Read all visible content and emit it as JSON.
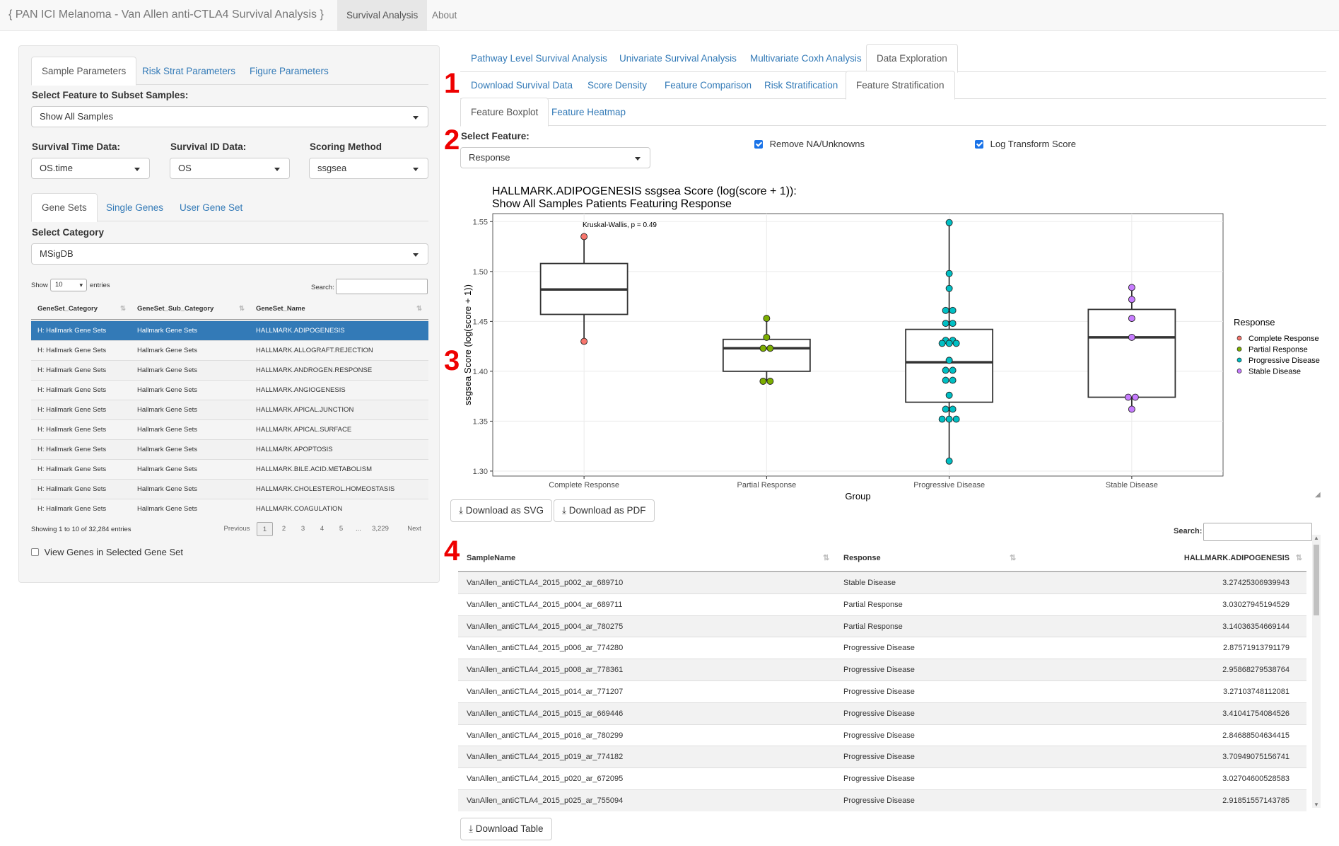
{
  "navbar": {
    "brand": "{ PAN ICI Melanoma - Van Allen anti-CTLA4 Survival Analysis }",
    "tabs": [
      "Survival Analysis",
      "About"
    ]
  },
  "sidebar": {
    "tabs": [
      "Sample Parameters",
      "Risk Strat Parameters",
      "Figure Parameters"
    ],
    "subset_label": "Select Feature to Subset Samples:",
    "subset_value": "Show All Samples",
    "survival_time_label": "Survival Time Data:",
    "survival_time_value": "OS.time",
    "survival_id_label": "Survival ID Data:",
    "survival_id_value": "OS",
    "scoring_label": "Scoring Method",
    "scoring_value": "ssgsea",
    "geneset_tabs": [
      "Gene Sets",
      "Single Genes",
      "User Gene Set"
    ],
    "category_label": "Select Category",
    "category_value": "MSigDB",
    "table": {
      "show": "Show",
      "length": "10",
      "entries": "entries",
      "search_label": "Search:",
      "columns": [
        "GeneSet_Category",
        "GeneSet_Sub_Category",
        "GeneSet_Name"
      ],
      "rows": [
        [
          "H: Hallmark Gene Sets",
          "Hallmark Gene Sets",
          "HALLMARK.ADIPOGENESIS"
        ],
        [
          "H: Hallmark Gene Sets",
          "Hallmark Gene Sets",
          "HALLMARK.ALLOGRAFT.REJECTION"
        ],
        [
          "H: Hallmark Gene Sets",
          "Hallmark Gene Sets",
          "HALLMARK.ANDROGEN.RESPONSE"
        ],
        [
          "H: Hallmark Gene Sets",
          "Hallmark Gene Sets",
          "HALLMARK.ANGIOGENESIS"
        ],
        [
          "H: Hallmark Gene Sets",
          "Hallmark Gene Sets",
          "HALLMARK.APICAL.JUNCTION"
        ],
        [
          "H: Hallmark Gene Sets",
          "Hallmark Gene Sets",
          "HALLMARK.APICAL.SURFACE"
        ],
        [
          "H: Hallmark Gene Sets",
          "Hallmark Gene Sets",
          "HALLMARK.APOPTOSIS"
        ],
        [
          "H: Hallmark Gene Sets",
          "Hallmark Gene Sets",
          "HALLMARK.BILE.ACID.METABOLISM"
        ],
        [
          "H: Hallmark Gene Sets",
          "Hallmark Gene Sets",
          "HALLMARK.CHOLESTEROL.HOMEOSTASIS"
        ],
        [
          "H: Hallmark Gene Sets",
          "Hallmark Gene Sets",
          "HALLMARK.COAGULATION"
        ]
      ],
      "info": "Showing 1 to 10 of 32,284 entries",
      "pagination": [
        "Previous",
        "1",
        "2",
        "3",
        "4",
        "5",
        "...",
        "3,229",
        "Next"
      ]
    },
    "view_genes": "View Genes in Selected Gene Set"
  },
  "main": {
    "tabs1": [
      "Pathway Level Survival Analysis",
      "Univariate Survival Analysis",
      "Multivariate Coxh Analysis",
      "Data Exploration"
    ],
    "tabs2": [
      "Download Survival Data",
      "Score Density",
      "Feature Comparison",
      "Risk Stratification",
      "Feature Stratification"
    ],
    "tabs3": [
      "Feature Boxplot",
      "Feature Heatmap"
    ],
    "markers": [
      "1",
      "2",
      "3",
      "4"
    ],
    "feature_label": "Select Feature:",
    "feature_value": "Response",
    "remove_na": "Remove NA/Unknowns",
    "log_transform": "Log Transform Score",
    "download_svg": "Download as SVG",
    "download_pdf": "Download as PDF",
    "search_label": "Search:",
    "table": {
      "columns": [
        "SampleName",
        "Response",
        "HALLMARK.ADIPOGENESIS"
      ],
      "rows": [
        [
          "VanAllen_antiCTLA4_2015_p002_ar_689710",
          "Stable Disease",
          "3.27425306939943"
        ],
        [
          "VanAllen_antiCTLA4_2015_p004_ar_689711",
          "Partial Response",
          "3.03027945194529"
        ],
        [
          "VanAllen_antiCTLA4_2015_p004_ar_780275",
          "Partial Response",
          "3.14036354669144"
        ],
        [
          "VanAllen_antiCTLA4_2015_p006_ar_774280",
          "Progressive Disease",
          "2.87571913791179"
        ],
        [
          "VanAllen_antiCTLA4_2015_p008_ar_778361",
          "Progressive Disease",
          "2.95868279538764"
        ],
        [
          "VanAllen_antiCTLA4_2015_p014_ar_771207",
          "Progressive Disease",
          "3.27103748112081"
        ],
        [
          "VanAllen_antiCTLA4_2015_p015_ar_669446",
          "Progressive Disease",
          "3.41041754084526"
        ],
        [
          "VanAllen_antiCTLA4_2015_p016_ar_780299",
          "Progressive Disease",
          "2.84688504634415"
        ],
        [
          "VanAllen_antiCTLA4_2015_p019_ar_774182",
          "Progressive Disease",
          "3.70949075156741"
        ],
        [
          "VanAllen_antiCTLA4_2015_p020_ar_672095",
          "Progressive Disease",
          "3.02704600528583"
        ],
        [
          "VanAllen_antiCTLA4_2015_p025_ar_755094",
          "Progressive Disease",
          "2.91851557143785"
        ]
      ]
    },
    "download_table": "Download Table"
  },
  "chart_data": {
    "type": "boxplot",
    "title": "HALLMARK.ADIPOGENESIS ssgsea Score (log(score + 1)):",
    "subtitle": "Show All Samples Patients Featuring Response",
    "xlabel": "Group",
    "ylabel": "ssgsea Score (log(score + 1))",
    "ylim": [
      1.295,
      1.558
    ],
    "yticks": [
      1.3,
      1.35,
      1.4,
      1.45,
      1.5,
      1.55
    ],
    "annotation": "Kruskal-Wallis, p = 0.49",
    "legend_title": "Response",
    "legend_position": "right",
    "grid": true,
    "categories": [
      "Complete Response",
      "Partial Response",
      "Progressive Disease",
      "Stable Disease"
    ],
    "colors": [
      "#f8766d",
      "#7cae00",
      "#00bfc4",
      "#c77cff"
    ],
    "boxes": [
      {
        "min": 1.43,
        "q1": 1.457,
        "median": 1.482,
        "q3": 1.508,
        "max": 1.535
      },
      {
        "min": 1.39,
        "q1": 1.4,
        "median": 1.423,
        "q3": 1.432,
        "max": 1.453
      },
      {
        "min": 1.31,
        "q1": 1.369,
        "median": 1.409,
        "q3": 1.442,
        "max": 1.549
      },
      {
        "min": 1.362,
        "q1": 1.374,
        "median": 1.434,
        "q3": 1.462,
        "max": 1.484
      }
    ],
    "points": [
      [
        1.535,
        1.43
      ],
      [
        1.453,
        1.434,
        1.423,
        1.423,
        1.39,
        1.39
      ],
      [
        1.549,
        1.498,
        1.483,
        1.461,
        1.461,
        1.448,
        1.448,
        1.431,
        1.431,
        1.428,
        1.428,
        1.428,
        1.411,
        1.401,
        1.401,
        1.391,
        1.391,
        1.376,
        1.362,
        1.362,
        1.352,
        1.352,
        1.352,
        1.31
      ],
      [
        1.484,
        1.472,
        1.453,
        1.434,
        1.374,
        1.374,
        1.362
      ]
    ]
  }
}
